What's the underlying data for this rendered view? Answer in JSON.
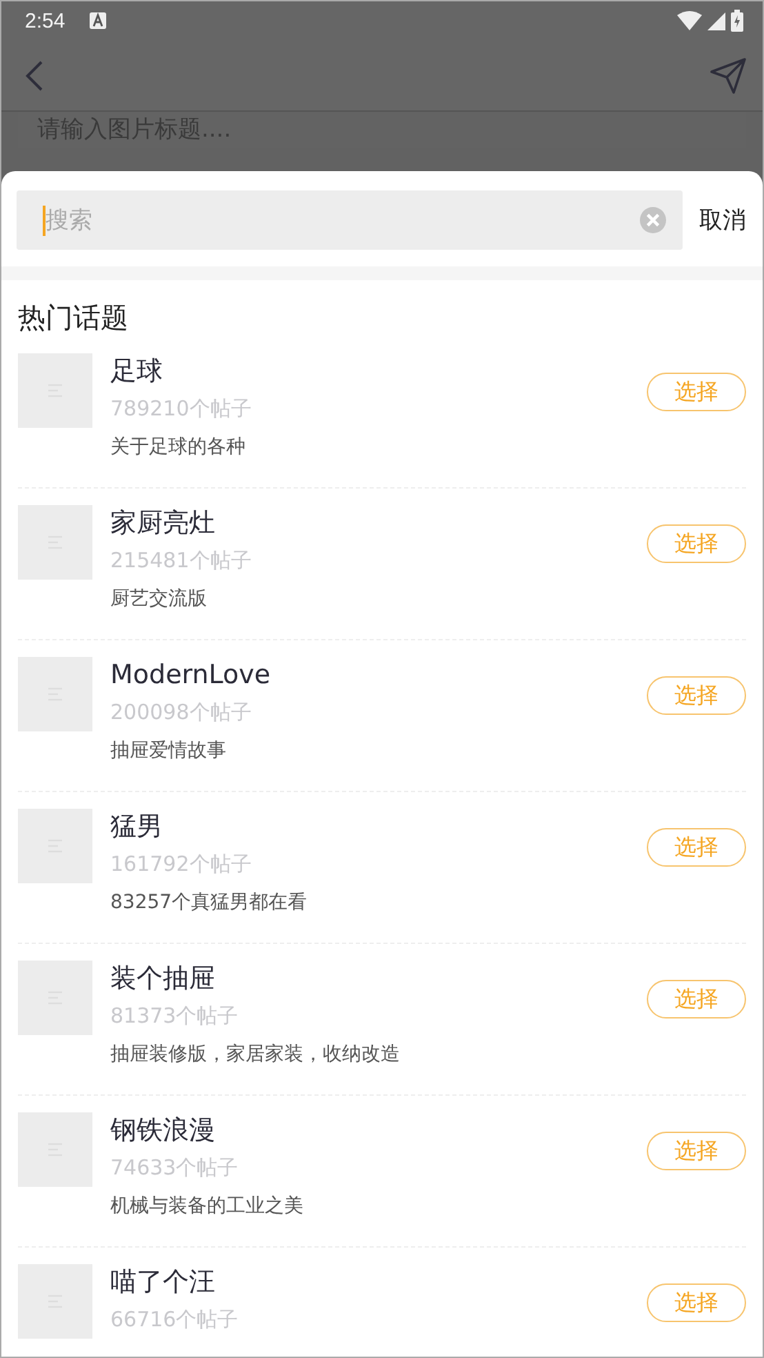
{
  "status_bar": {
    "time": "2:54"
  },
  "background": {
    "title_placeholder": "请输入图片标题...."
  },
  "search": {
    "placeholder": "搜索",
    "cancel": "取消"
  },
  "section_title": "热门话题",
  "topics": [
    {
      "name": "足球",
      "posts": "789210个帖子",
      "description": "关于足球的各种",
      "action": "选择"
    },
    {
      "name": "家厨亮灶",
      "posts": "215481个帖子",
      "description": "厨艺交流版",
      "action": "选择"
    },
    {
      "name": "ModernLove",
      "posts": "200098个帖子",
      "description": "抽屉爱情故事",
      "action": "选择"
    },
    {
      "name": "猛男",
      "posts": "161792个帖子",
      "description": "83257个真猛男都在看",
      "action": "选择"
    },
    {
      "name": "装个抽屉",
      "posts": "81373个帖子",
      "description": "抽屉装修版，家居家装，收纳改造",
      "action": "选择"
    },
    {
      "name": "钢铁浪漫",
      "posts": "74633个帖子",
      "description": "机械与装备的工业之美",
      "action": "选择"
    },
    {
      "name": "喵了个汪",
      "posts": "66716个帖子",
      "action": "选择"
    }
  ]
}
